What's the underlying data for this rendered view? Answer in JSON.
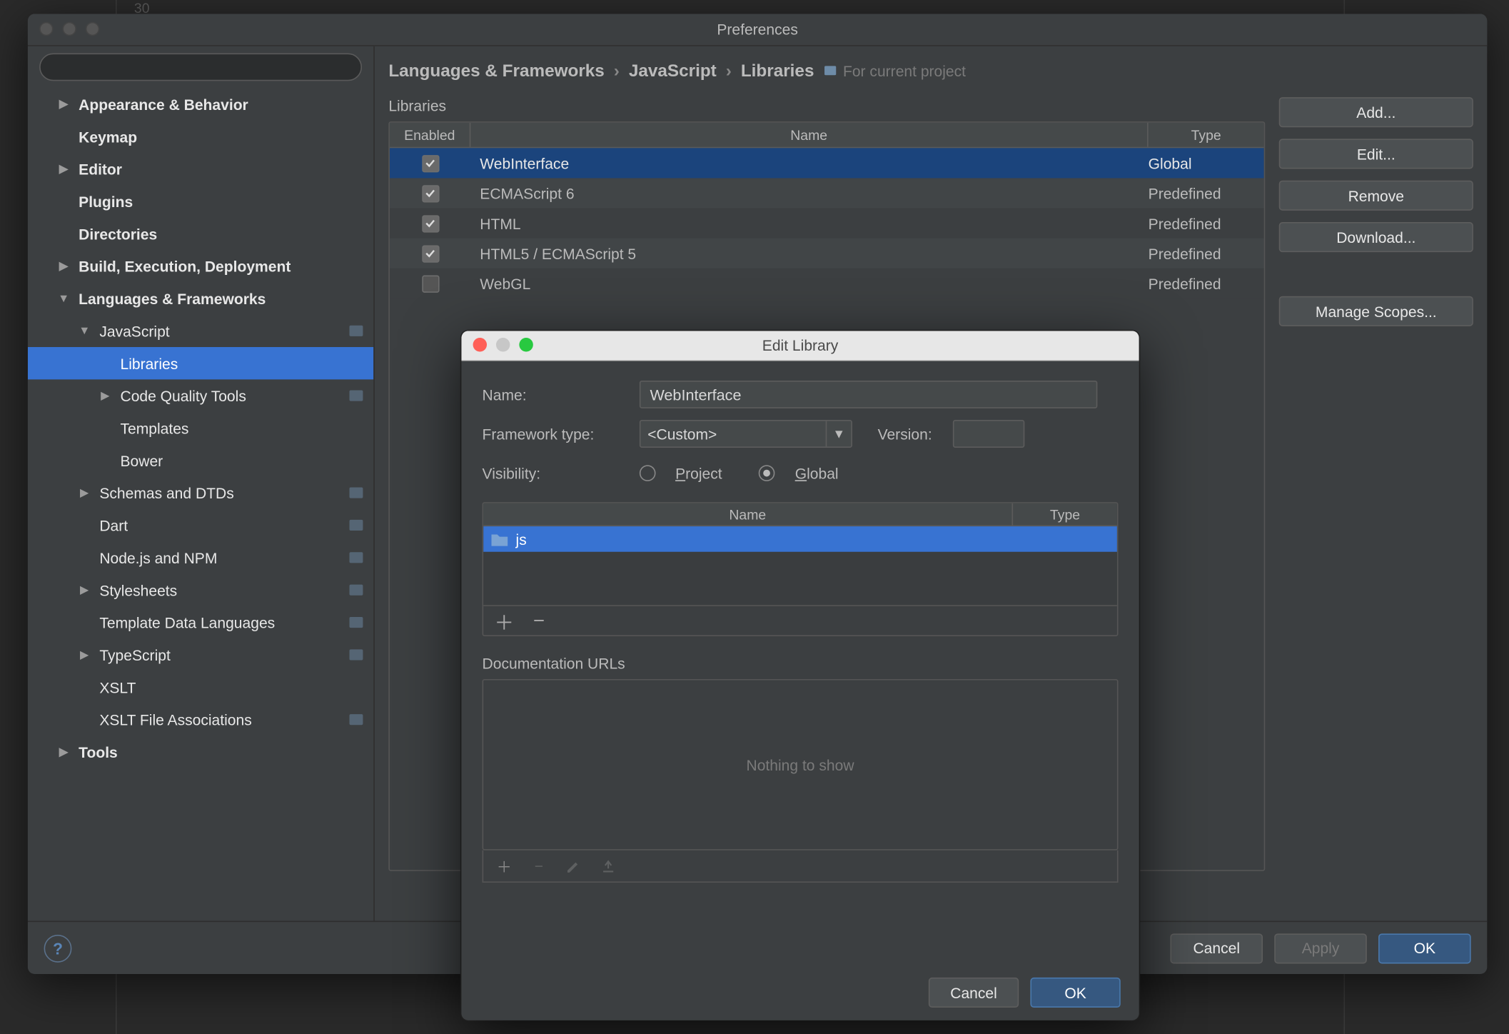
{
  "backdrop": {
    "line_number": "30"
  },
  "prefs_window": {
    "title": "Preferences",
    "search_placeholder": "",
    "footer": {
      "cancel": "Cancel",
      "apply": "Apply",
      "ok": "OK"
    }
  },
  "sidebar": {
    "items": [
      {
        "label": "Appearance & Behavior",
        "depth": 0,
        "bold": true,
        "arrow": "right"
      },
      {
        "label": "Keymap",
        "depth": 0,
        "bold": true
      },
      {
        "label": "Editor",
        "depth": 0,
        "bold": true,
        "arrow": "right"
      },
      {
        "label": "Plugins",
        "depth": 0,
        "bold": true
      },
      {
        "label": "Directories",
        "depth": 0,
        "bold": true
      },
      {
        "label": "Build, Execution, Deployment",
        "depth": 0,
        "bold": true,
        "arrow": "right"
      },
      {
        "label": "Languages & Frameworks",
        "depth": 0,
        "bold": true,
        "arrow": "down"
      },
      {
        "label": "JavaScript",
        "depth": 1,
        "arrow": "down",
        "scope": true
      },
      {
        "label": "Libraries",
        "depth": 2,
        "selected": true
      },
      {
        "label": "Code Quality Tools",
        "depth": 2,
        "arrow": "right",
        "scope": true
      },
      {
        "label": "Templates",
        "depth": 2
      },
      {
        "label": "Bower",
        "depth": 2
      },
      {
        "label": "Schemas and DTDs",
        "depth": 1,
        "arrow": "right",
        "scope": true
      },
      {
        "label": "Dart",
        "depth": 1,
        "scope": true
      },
      {
        "label": "Node.js and NPM",
        "depth": 1,
        "scope": true
      },
      {
        "label": "Stylesheets",
        "depth": 1,
        "arrow": "right",
        "scope": true
      },
      {
        "label": "Template Data Languages",
        "depth": 1,
        "scope": true
      },
      {
        "label": "TypeScript",
        "depth": 1,
        "arrow": "right",
        "scope": true
      },
      {
        "label": "XSLT",
        "depth": 1
      },
      {
        "label": "XSLT File Associations",
        "depth": 1,
        "scope": true
      },
      {
        "label": "Tools",
        "depth": 0,
        "bold": true,
        "arrow": "right"
      }
    ]
  },
  "breadcrumb": {
    "parts": [
      "Languages & Frameworks",
      "JavaScript",
      "Libraries"
    ],
    "scope_text": "For current project"
  },
  "libraries": {
    "heading": "Libraries",
    "columns": {
      "enabled": "Enabled",
      "name": "Name",
      "type": "Type"
    },
    "rows": [
      {
        "enabled": true,
        "name": "WebInterface",
        "type": "Global",
        "selected": true
      },
      {
        "enabled": true,
        "name": "ECMAScript 6",
        "type": "Predefined"
      },
      {
        "enabled": true,
        "name": "HTML",
        "type": "Predefined"
      },
      {
        "enabled": true,
        "name": "HTML5 / ECMAScript 5",
        "type": "Predefined"
      },
      {
        "enabled": false,
        "name": "WebGL",
        "type": "Predefined"
      }
    ]
  },
  "buttons": {
    "add": "Add...",
    "edit": "Edit...",
    "remove": "Remove",
    "download": "Download...",
    "manage_scopes": "Manage Scopes..."
  },
  "dialog": {
    "title": "Edit Library",
    "name_label": "Name:",
    "name_value": "WebInterface",
    "framework_label": "Framework type:",
    "framework_value": "<Custom>",
    "version_label": "Version:",
    "version_value": "",
    "visibility_label": "Visibility:",
    "visibility_options": {
      "project": "Project",
      "global": "Global"
    },
    "visibility_selected": "global",
    "file_columns": {
      "name": "Name",
      "type": "Type"
    },
    "file_rows": [
      {
        "name": "js",
        "icon": "folder"
      }
    ],
    "docs_label": "Documentation URLs",
    "docs_empty": "Nothing to show",
    "footer": {
      "cancel": "Cancel",
      "ok": "OK"
    }
  }
}
